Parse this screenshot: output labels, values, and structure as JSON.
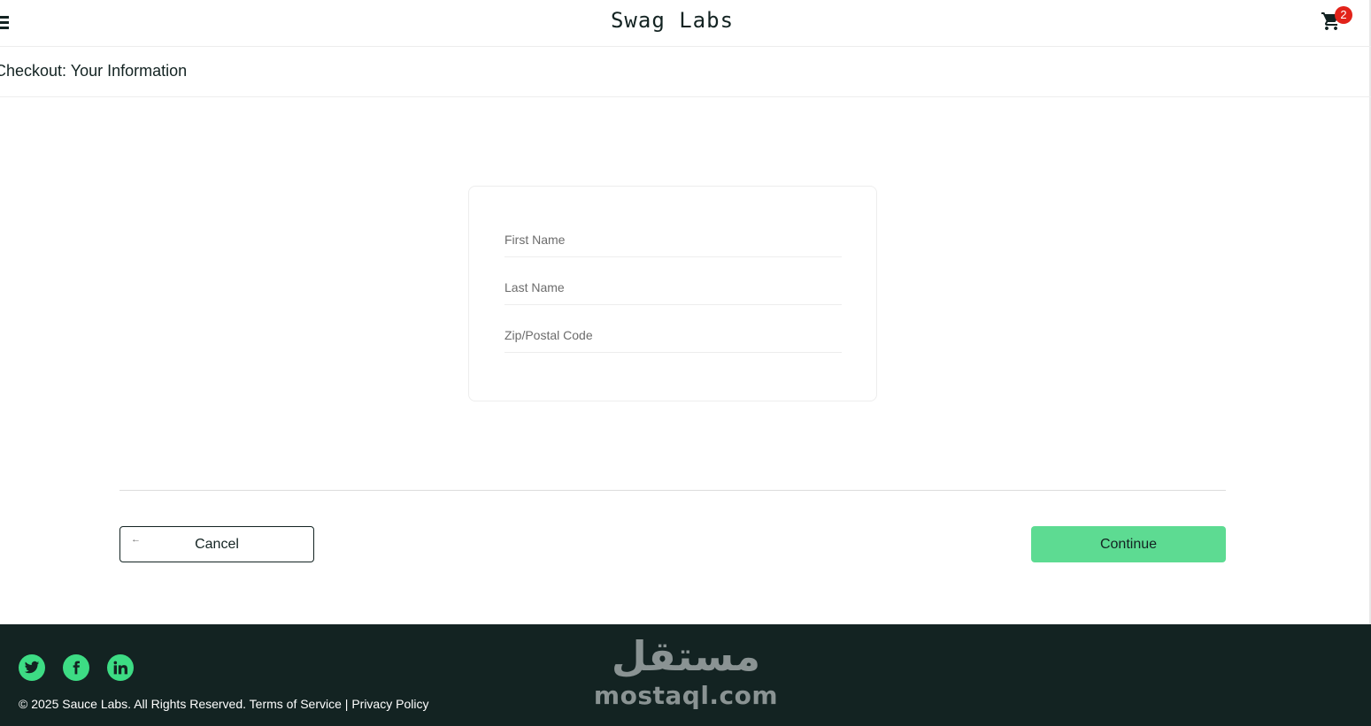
{
  "header": {
    "app_title": "Swag Labs",
    "cart_count": "2",
    "menu_icon": "hamburger-icon",
    "cart_icon": "shopping-cart-icon"
  },
  "subheader": {
    "title": "Checkout: Your Information"
  },
  "form": {
    "first_name": {
      "value": "",
      "placeholder": "First Name"
    },
    "last_name": {
      "value": "",
      "placeholder": "Last Name"
    },
    "postal_code": {
      "value": "",
      "placeholder": "Zip/Postal Code"
    }
  },
  "actions": {
    "cancel_label": "Cancel",
    "cancel_icon": "arrow-left-icon",
    "cancel_arrow": "←",
    "continue_label": "Continue"
  },
  "footer": {
    "social": [
      "twitter-icon",
      "facebook-icon",
      "linkedin-icon"
    ],
    "copyright": "© 2025 Sauce Labs. All Rights Reserved. Terms of Service | Privacy Policy",
    "watermark_arabic": "مستقل",
    "watermark_latin": "mostaql.com"
  },
  "colors": {
    "primary_text": "#132322",
    "accent_green": "#5ddb92",
    "badge_red": "#e2231a",
    "footer_bg": "#132322",
    "social_green": "#3ddc84"
  }
}
